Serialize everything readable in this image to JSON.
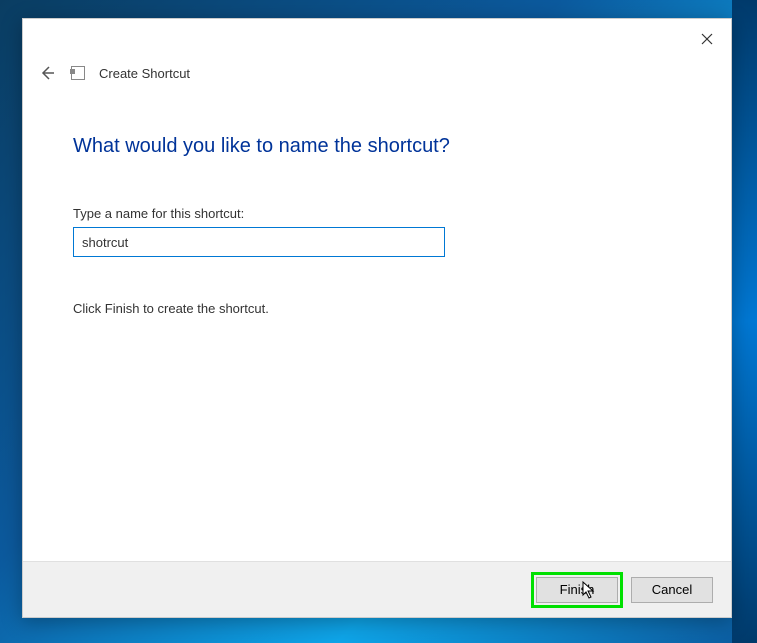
{
  "header": {
    "title": "Create Shortcut"
  },
  "content": {
    "heading": "What would you like to name the shortcut?",
    "field_label": "Type a name for this shortcut:",
    "input_value": "shotrcut",
    "instruction": "Click Finish to create the shortcut."
  },
  "buttons": {
    "finish": "Finish",
    "cancel": "Cancel"
  }
}
